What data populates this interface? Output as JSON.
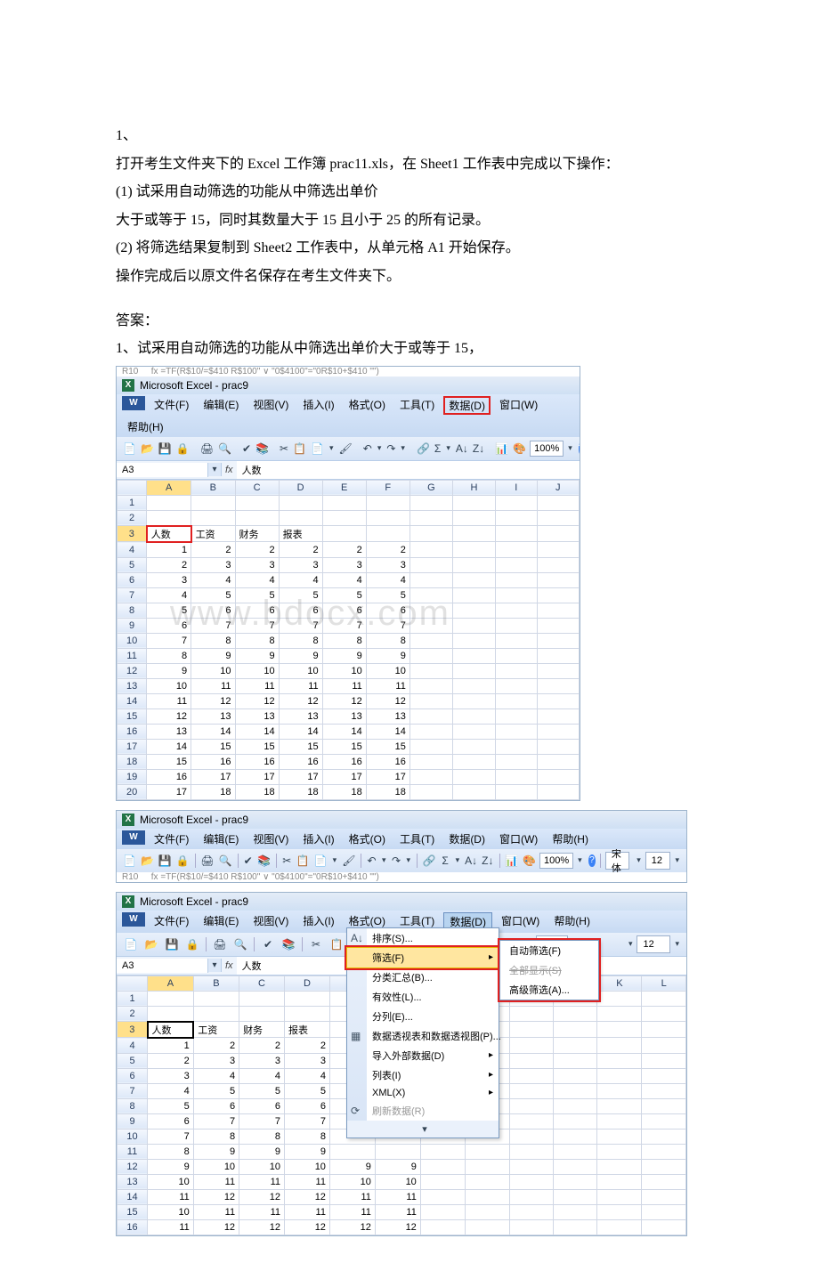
{
  "question": {
    "num": "1、",
    "line1": "打开考生文件夹下的 Excel 工作簿 prac11.xls，在 Sheet1 工作表中完成以下操作：",
    "line2": "(1) 试采用自动筛选的功能从中筛选出单价",
    "line3": "大于或等于 15，同时其数量大于 15 且小于 25 的所有记录。",
    "line4": "(2) 将筛选结果复制到 Sheet2 工作表中，从单元格 A1 开始保存。",
    "line5": "操作完成后以原文件名保存在考生文件夹下。"
  },
  "answer": {
    "label": "答案：",
    "step1": "1、试采用自动筛选的功能从中筛选出单价大于或等于 15，"
  },
  "excel": {
    "title": "Microsoft Excel - prac9",
    "menus": {
      "file": "文件(F)",
      "edit": "编辑(E)",
      "view": "视图(V)",
      "insert": "插入(I)",
      "format": "格式(O)",
      "tools": "工具(T)",
      "data": "数据(D)",
      "window": "窗口(W)",
      "help": "帮助(H)"
    },
    "namebox": "A3",
    "fx": "fx",
    "formula": "人数",
    "formula_top": "=TF(R$10/=$410 R$100\" ∨ \"0$4100\"=\"0R$10+$410 \"\")",
    "zoom": "100%",
    "font": "宋体",
    "fontsize": "12",
    "cols": [
      "A",
      "B",
      "C",
      "D",
      "E",
      "F",
      "G",
      "H",
      "I",
      "J",
      "K",
      "L"
    ],
    "headers": {
      "a": "人数",
      "b": "工资",
      "c": "财务",
      "d": "报表"
    },
    "rows": [
      [
        1,
        2,
        2,
        2,
        2,
        2
      ],
      [
        2,
        3,
        3,
        3,
        3,
        3
      ],
      [
        3,
        4,
        4,
        4,
        4,
        4
      ],
      [
        4,
        5,
        5,
        5,
        5,
        5
      ],
      [
        5,
        6,
        6,
        6,
        6,
        6
      ],
      [
        6,
        7,
        7,
        7,
        7,
        7
      ],
      [
        7,
        8,
        8,
        8,
        8,
        8
      ],
      [
        8,
        9,
        9,
        9,
        9,
        9
      ],
      [
        9,
        10,
        10,
        10,
        10,
        10
      ],
      [
        10,
        11,
        11,
        11,
        11,
        11
      ],
      [
        11,
        12,
        12,
        12,
        12,
        12
      ],
      [
        12,
        13,
        13,
        13,
        13,
        13
      ],
      [
        13,
        14,
        14,
        14,
        14,
        14
      ],
      [
        14,
        15,
        15,
        15,
        15,
        15
      ],
      [
        15,
        16,
        16,
        16,
        16,
        16
      ],
      [
        16,
        17,
        17,
        17,
        17,
        17
      ],
      [
        17,
        18,
        18,
        18,
        18,
        18
      ]
    ],
    "rows2": [
      [
        1,
        2,
        2,
        2
      ],
      [
        2,
        3,
        3,
        3
      ],
      [
        3,
        4,
        4,
        4
      ],
      [
        4,
        5,
        5,
        5
      ],
      [
        5,
        6,
        6,
        6
      ],
      [
        6,
        7,
        7,
        7
      ],
      [
        7,
        8,
        8,
        8
      ],
      [
        8,
        9,
        9,
        9
      ],
      [
        9,
        10,
        10,
        10,
        9,
        9
      ],
      [
        10,
        11,
        11,
        11,
        10,
        10
      ],
      [
        11,
        12,
        12,
        12,
        11,
        11
      ],
      [
        10,
        11,
        11,
        11,
        11,
        11
      ],
      [
        11,
        12,
        12,
        12,
        12,
        12
      ]
    ]
  },
  "datamenu": {
    "sort": "排序(S)...",
    "filter": "筛选(F)",
    "subtotal": "分类汇总(B)...",
    "validation": "有效性(L)...",
    "texttocol": "分列(E)...",
    "pivot": "数据透视表和数据透视图(P)...",
    "import": "导入外部数据(D)",
    "list": "列表(I)",
    "xml": "XML(X)",
    "refresh": "刷新数据(R)",
    "expand": "▾"
  },
  "filtersub": {
    "auto": "自动筛选(F)",
    "showall": "全部显示(S)",
    "advanced": "高级筛选(A)..."
  },
  "watermark": "www.bdocx.com"
}
